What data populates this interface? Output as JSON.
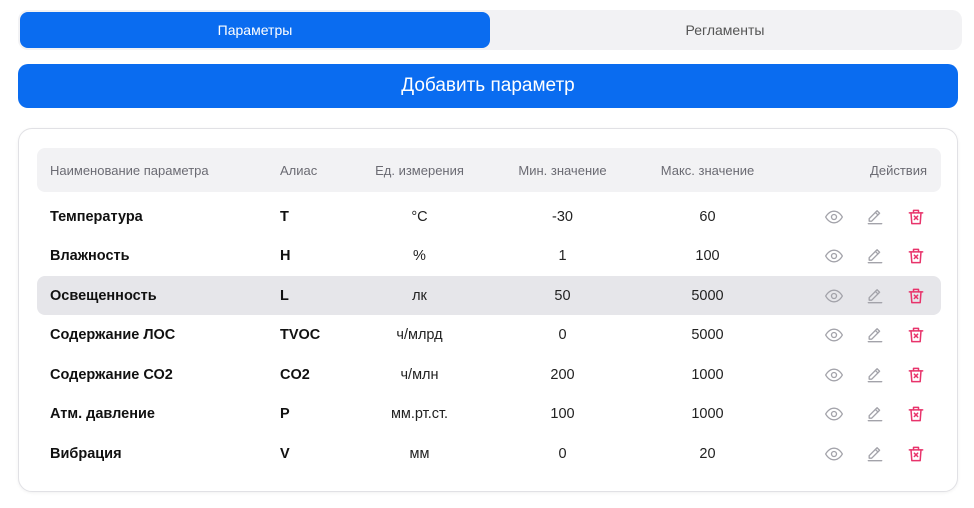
{
  "tabs": [
    {
      "label": "Параметры",
      "active": true
    },
    {
      "label": "Регламенты",
      "active": false
    }
  ],
  "add_button": {
    "label": "Добавить параметр"
  },
  "table": {
    "headers": {
      "name": "Наименование параметра",
      "alias": "Алиас",
      "unit": "Ед. измерения",
      "min": "Мин. значение",
      "max": "Макс. значение",
      "actions": "Действия"
    },
    "rows": [
      {
        "name": "Температура",
        "alias": "T",
        "unit": "°C",
        "min": "-30",
        "max": "60"
      },
      {
        "name": "Влажность",
        "alias": "H",
        "unit": "%",
        "min": "1",
        "max": "100"
      },
      {
        "name": "Освещенность",
        "alias": "L",
        "unit": "лк",
        "min": "50",
        "max": "5000"
      },
      {
        "name": "Содержание ЛОС",
        "alias": "TVOC",
        "unit": "ч/млрд",
        "min": "0",
        "max": "5000"
      },
      {
        "name": "Содержание СО2",
        "alias": "CO2",
        "unit": "ч/млн",
        "min": "200",
        "max": "1000"
      },
      {
        "name": "Атм. давление",
        "alias": "P",
        "unit": "мм.рт.ст.",
        "min": "100",
        "max": "1000"
      },
      {
        "name": "Вибрация",
        "alias": "V",
        "unit": "мм",
        "min": "0",
        "max": "20"
      }
    ],
    "highlighted_row": 2,
    "row_icons": [
      "eye-icon",
      "edit-icon",
      "trash-icon"
    ]
  },
  "colors": {
    "accent": "#0a6cf0",
    "icon_gray": "#a3a3aa",
    "delete": "#e8336b"
  }
}
